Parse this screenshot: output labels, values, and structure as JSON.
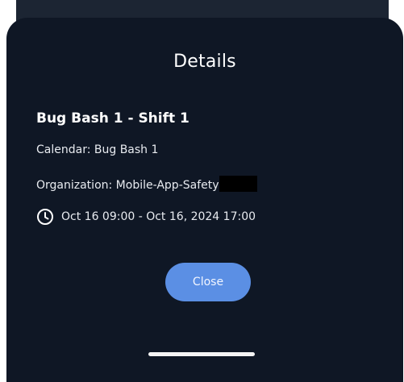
{
  "dialog": {
    "title": "Details",
    "event_name": "Bug Bash 1 - Shift 1",
    "calendar": "Calendar: Bug Bash 1",
    "organization": "Organization: Mobile-App-Safety",
    "time_range": "Oct 16 09:00 - Oct 16, 2024 17:00",
    "close_label": "Close"
  },
  "icons": {
    "time": "clock-icon"
  },
  "colors": {
    "sheet_background": "#0f1725",
    "button_accent": "#5b8fe4",
    "text_primary": "#ffffff"
  }
}
